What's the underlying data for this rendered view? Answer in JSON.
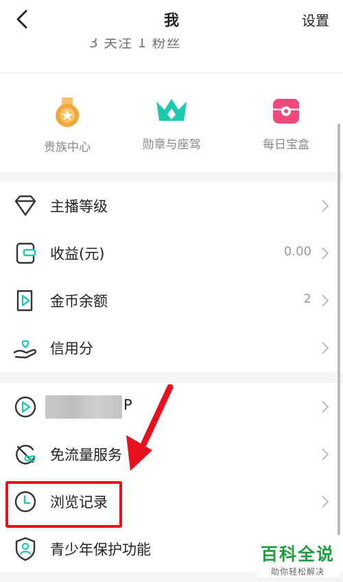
{
  "header": {
    "title": "我",
    "settings_label": "设置"
  },
  "stats": {
    "partial_text": "3 关注    1 粉丝"
  },
  "quick_actions": [
    {
      "label": "贵族中心",
      "icon": "medal-icon",
      "color": "#f0a63a"
    },
    {
      "label": "勋章与座驾",
      "icon": "crown-icon",
      "color": "#1ec8b0"
    },
    {
      "label": "每日宝盒",
      "icon": "treasure-box-icon",
      "color": "#f0487a"
    }
  ],
  "menu_group_1": [
    {
      "label": "主播等级",
      "value": "",
      "icon": "diamond-icon"
    },
    {
      "label": "收益(元)",
      "value": "0.00",
      "icon": "wallet-icon"
    },
    {
      "label": "金币余额",
      "value": "2",
      "icon": "coin-card-icon"
    },
    {
      "label": "信用分",
      "value": "",
      "icon": "hand-heart-icon"
    }
  ],
  "menu_group_2": [
    {
      "label": "P",
      "value": "",
      "icon": "play-circle-icon"
    },
    {
      "label": "免流量服务",
      "value": "",
      "icon": "data-free-icon"
    },
    {
      "label": "浏览记录",
      "value": "",
      "icon": "clock-icon"
    },
    {
      "label": "青少年保护功能",
      "value": "",
      "icon": "shield-person-icon"
    }
  ],
  "watermark": {
    "main": "百科全说",
    "sub": "助你轻松解决"
  },
  "colors": {
    "accent": "#1ec8b0",
    "highlight": "#e8101c",
    "watermark": "#1f9d3f"
  }
}
